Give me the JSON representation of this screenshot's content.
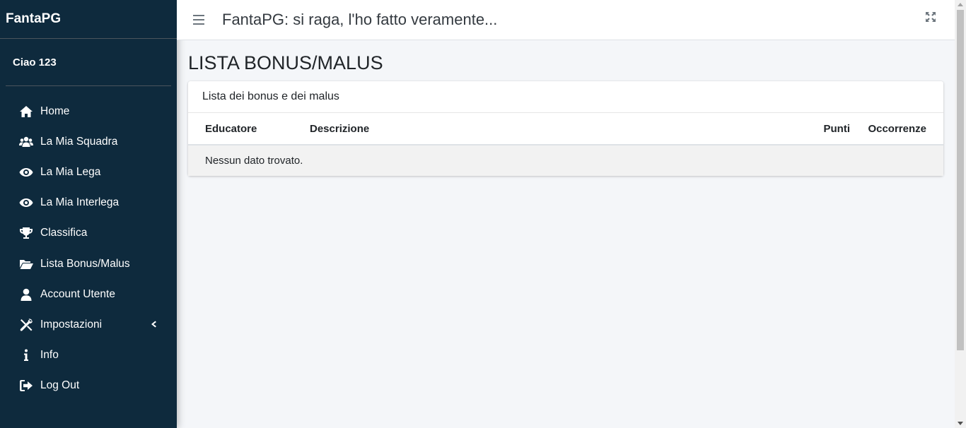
{
  "brand": {
    "name": "FantaPG"
  },
  "user": {
    "greeting": "Ciao 123"
  },
  "sidebar": {
    "items": [
      {
        "label": "Home",
        "icon": "home-icon"
      },
      {
        "label": "La Mia Squadra",
        "icon": "users-icon"
      },
      {
        "label": "La Mia Lega",
        "icon": "eye-icon"
      },
      {
        "label": "La Mia Interlega",
        "icon": "eye-icon"
      },
      {
        "label": "Classifica",
        "icon": "trophy-icon"
      },
      {
        "label": "Lista Bonus/Malus",
        "icon": "folder-open-icon"
      },
      {
        "label": "Account Utente",
        "icon": "user-icon"
      },
      {
        "label": "Impostazioni",
        "icon": "tools-icon"
      },
      {
        "label": "Info",
        "icon": "info-icon"
      },
      {
        "label": "Log Out",
        "icon": "sign-out-icon"
      }
    ]
  },
  "header": {
    "title": "FantaPG: si raga, l'ho fatto veramente..."
  },
  "main": {
    "heading": "LISTA BONUS/MALUS",
    "card": {
      "title": "Lista dei bonus e dei malus",
      "columns": [
        "Educatore",
        "Descrizione",
        "Punti",
        "Occorrenze"
      ],
      "empty_text": "Nessun dato trovato."
    }
  },
  "colors": {
    "sidebar_bg": "#0e2a3d",
    "page_bg": "#f4f6f9"
  }
}
